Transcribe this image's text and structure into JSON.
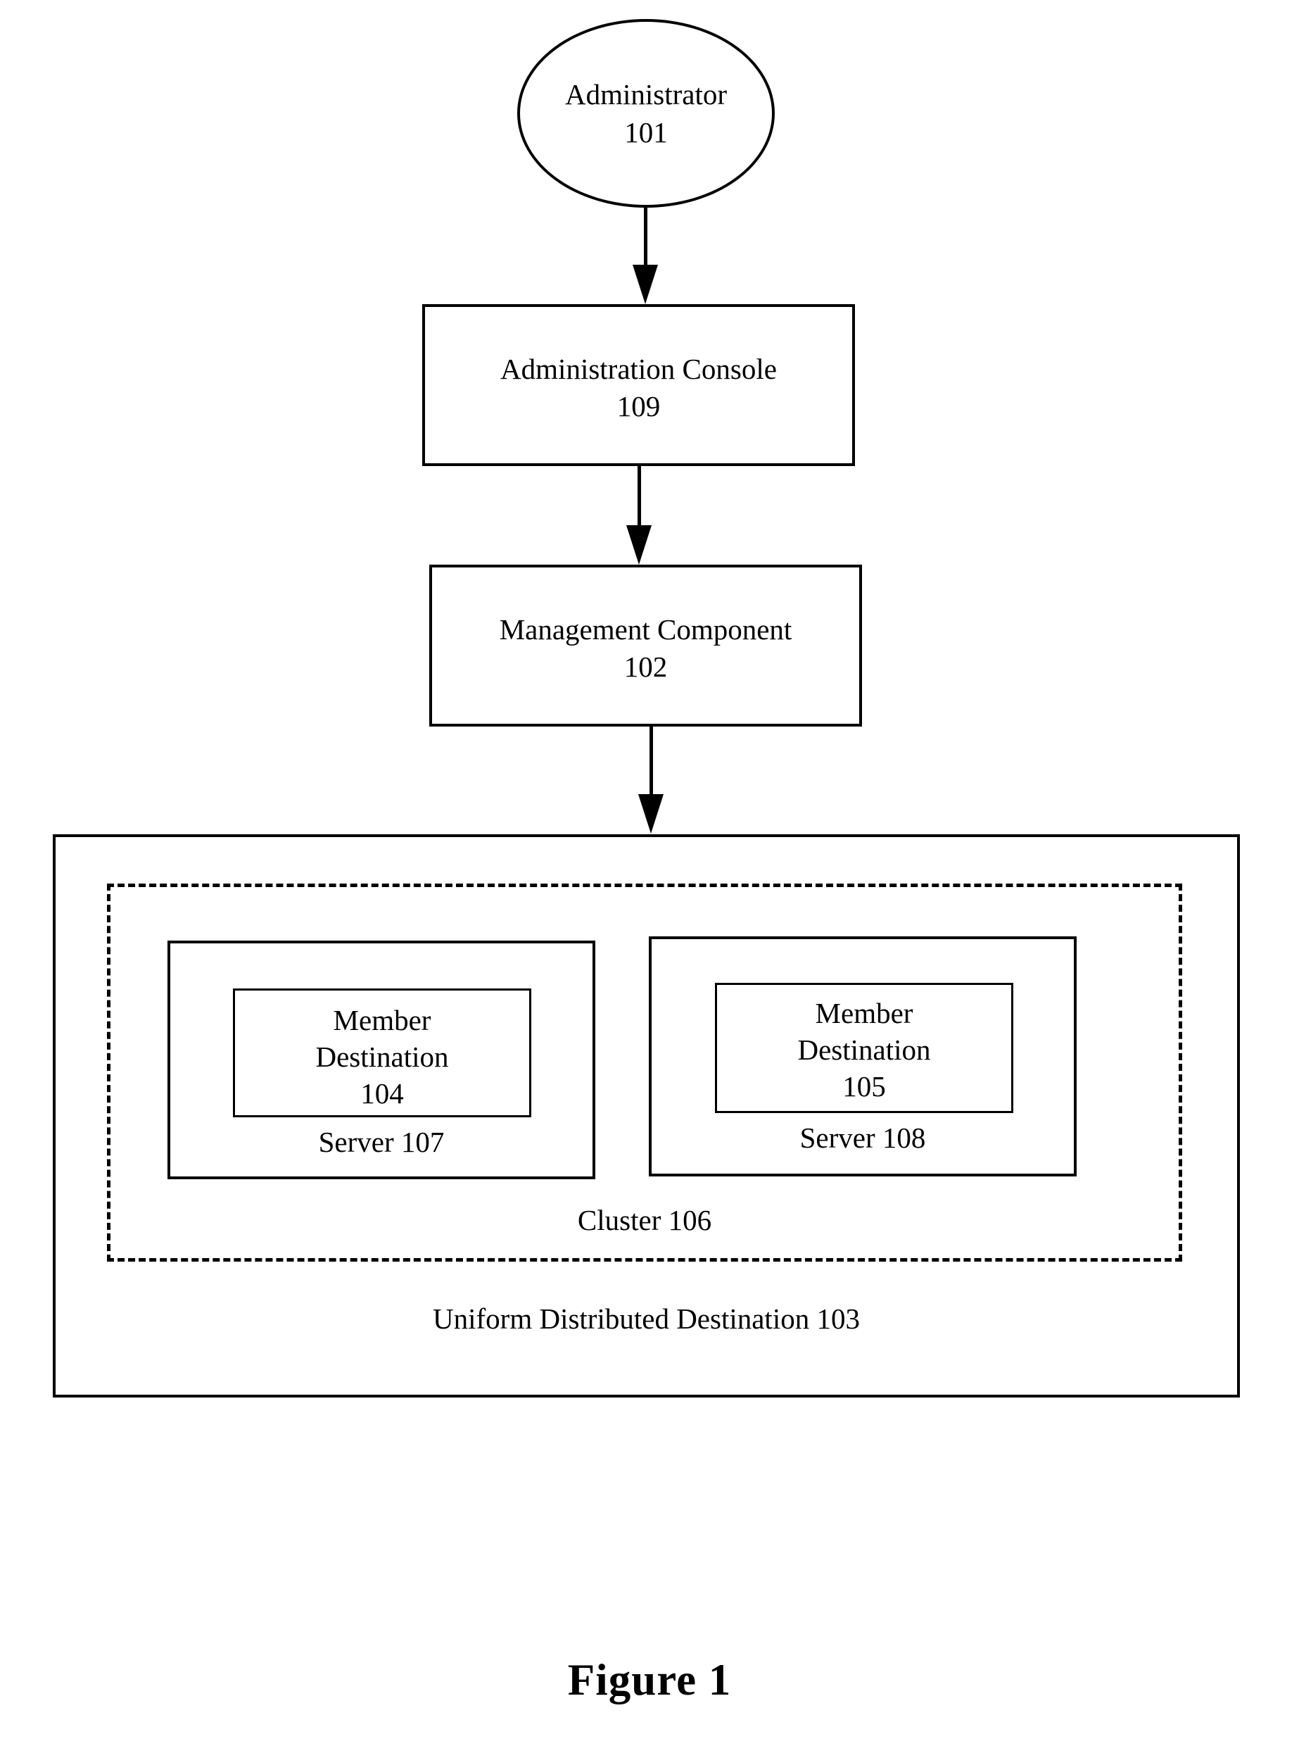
{
  "figure": {
    "caption": "Figure 1"
  },
  "nodes": {
    "administrator": {
      "label": "Administrator",
      "ref": "101"
    },
    "administration_console": {
      "label": "Administration Console",
      "ref": "109"
    },
    "management_component": {
      "label": "Management Component",
      "ref": "102"
    },
    "uniform_distributed_destination": {
      "label": "Uniform Distributed Destination 103"
    },
    "cluster": {
      "label": "Cluster  106"
    },
    "server_107": {
      "label": "Server 107"
    },
    "server_108": {
      "label": "Server 108"
    },
    "member_destination_104": {
      "line1": "Member",
      "line2": "Destination",
      "ref": "104"
    },
    "member_destination_105": {
      "line1": "Member",
      "line2": "Destination",
      "ref": "105"
    }
  },
  "connectors": [
    {
      "name": "administrator-to-console",
      "from": "administrator",
      "to": "administration_console",
      "style": "solid-arrow"
    },
    {
      "name": "console-to-management",
      "from": "administration_console",
      "to": "management_component",
      "style": "solid-arrow"
    },
    {
      "name": "management-to-udd",
      "from": "management_component",
      "to": "uniform_distributed_destination",
      "style": "solid-arrow"
    }
  ],
  "colors": {
    "stroke": "#000000",
    "background": "#ffffff"
  }
}
